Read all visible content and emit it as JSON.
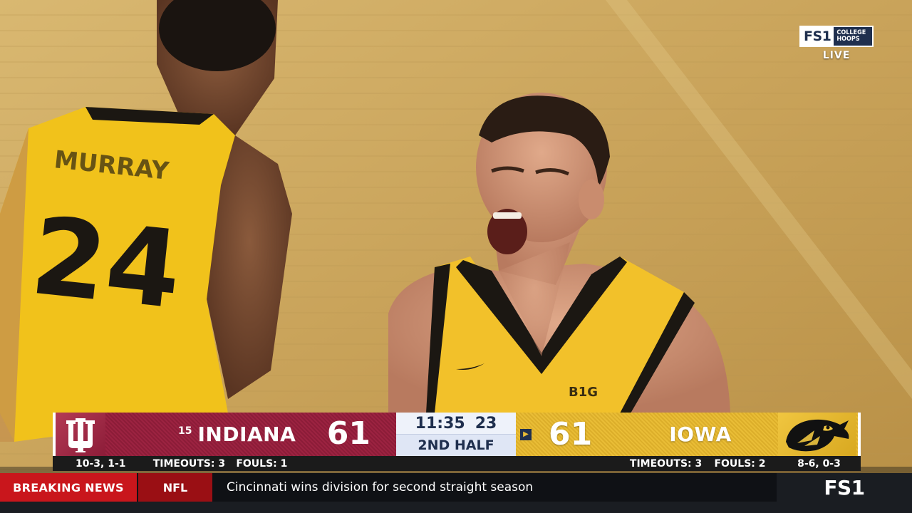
{
  "broadcast": {
    "network_logo": "FS1",
    "channel_text": "COLLEGE HOOPS",
    "live_label": "LIVE"
  },
  "scoreboard": {
    "home": {
      "rank": "15",
      "name": "INDIANA",
      "score": "61",
      "record": "10-3, 1-1",
      "timeouts": "TIMEOUTS: 3",
      "fouls": "FOULS: 1",
      "logo_icon": "indiana-iu-logo",
      "color": "#9c2341"
    },
    "away": {
      "name": "IOWA",
      "score": "61",
      "record": "8-6, 0-3",
      "timeouts": "TIMEOUTS: 3",
      "fouls": "FOULS: 2",
      "logo_icon": "iowa-hawkeye-logo",
      "color": "#e9bd36",
      "possession_icon": "possession-arrow-icon"
    },
    "clock": "11:35",
    "shot_clock": "23",
    "period": "2ND HALF"
  },
  "ticker": {
    "breaking": "BREAKING NEWS",
    "category": "NFL",
    "headline": "Cincinnati wins division for second straight season",
    "network": "FS1"
  },
  "scene": {
    "jersey_number": "24",
    "jersey_name": "MURRAY"
  }
}
